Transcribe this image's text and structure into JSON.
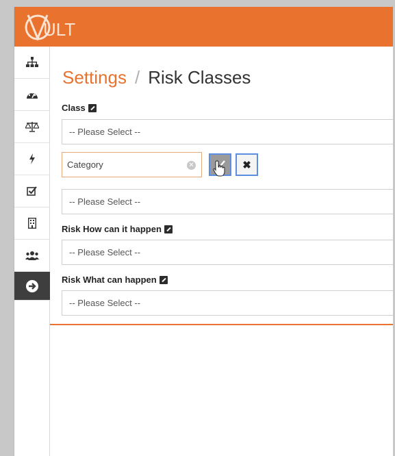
{
  "app": {
    "logo_text": "ULT"
  },
  "sidebar": {
    "items": [
      {
        "icon": "sitemap-icon"
      },
      {
        "icon": "dashboard-icon"
      },
      {
        "icon": "balance-scale-icon"
      },
      {
        "icon": "bolt-icon"
      },
      {
        "icon": "checkbox-icon"
      },
      {
        "icon": "building-icon"
      },
      {
        "icon": "users-icon"
      },
      {
        "icon": "arrow-right-circle-icon",
        "active": true
      }
    ]
  },
  "header": {
    "breadcrumb": "Settings",
    "separator": "/",
    "title": "Risk Classes"
  },
  "form": {
    "class_label": "Class",
    "class_select": "-- Please Select --",
    "category_input": "Category",
    "category_select": "-- Please Select --",
    "how_label": "Risk How can it happen",
    "how_select": "-- Please Select --",
    "what_label": "Risk What can happen",
    "what_select": "-- Please Select --",
    "cancel_glyph": "✖"
  },
  "colors": {
    "accent": "#e8722e",
    "sidebar_active": "#3e3e3e",
    "focus_border": "#5b8ee0"
  }
}
